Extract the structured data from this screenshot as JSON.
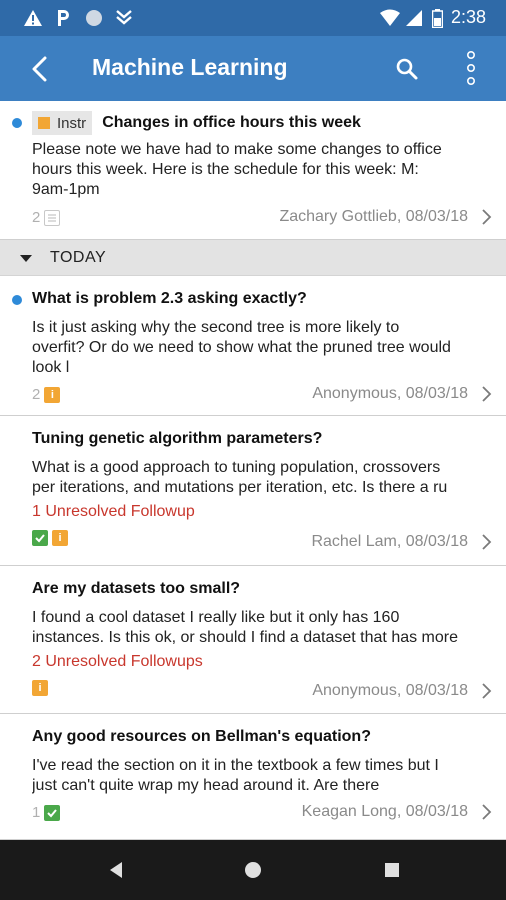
{
  "status_bar": {
    "time": "2:38",
    "icons": [
      "warning-icon",
      "parking-icon",
      "circle-icon",
      "download-icon",
      "wifi-icon",
      "signal-icon",
      "battery-icon"
    ]
  },
  "app_bar": {
    "title": "Machine Learning",
    "back_icon": "back-arrow-icon",
    "search_icon": "search-icon",
    "more_icon": "more-vert-icon"
  },
  "pinned_post": {
    "tag_label": "Instr",
    "subject": "Changes in office hours this week",
    "body_lines": [
      "Please note we have had to make some changes to office",
      "hours this week. Here is the schedule for this week: M:",
      "9am-1pm"
    ],
    "count": "2",
    "author_date": "Zachary Gottlieb, 08/03/18"
  },
  "section": {
    "label": "TODAY"
  },
  "posts": [
    {
      "subject": "What is problem 2.3 asking exactly?",
      "body_lines": [
        "Is it just asking why the second tree is more likely to",
        "overfit? Or do we need to show what the pruned tree would",
        "look l"
      ],
      "followups": "",
      "count": "2",
      "author_date": "Anonymous, 08/03/18"
    },
    {
      "subject": "Tuning genetic algorithm parameters?",
      "body_lines": [
        "What is a good approach to tuning population, crossovers",
        "per iterations, and mutations per iteration, etc. Is there a ru"
      ],
      "followups": "1 Unresolved Followup",
      "count": "",
      "author_date": "Rachel Lam, 08/03/18"
    },
    {
      "subject": "Are my datasets too small?",
      "body_lines": [
        "I found a cool dataset I really like but it only has 160",
        "instances. Is this ok, or should I find a dataset that has more"
      ],
      "followups": "2 Unresolved Followups",
      "count": "",
      "author_date": "Anonymous, 08/03/18"
    },
    {
      "subject": "Any good resources on Bellman's equation?",
      "body_lines": [
        "I've read the section on it in the textbook a few times but I",
        "just can't quite wrap my head around it. Are there"
      ],
      "followups": "",
      "count": "1",
      "author_date": "Keagan Long, 08/03/18"
    }
  ],
  "colors": {
    "status_bar": "#2f6aa8",
    "app_bar": "#3d7fc1",
    "unread_dot": "#2e8ad8",
    "instructor_badge": "#f2a634",
    "student_badge": "#4aa84a",
    "followup_text": "#c8372d"
  },
  "nav_bar": {
    "icons": [
      "nav-back-icon",
      "nav-home-icon",
      "nav-recents-icon"
    ]
  }
}
